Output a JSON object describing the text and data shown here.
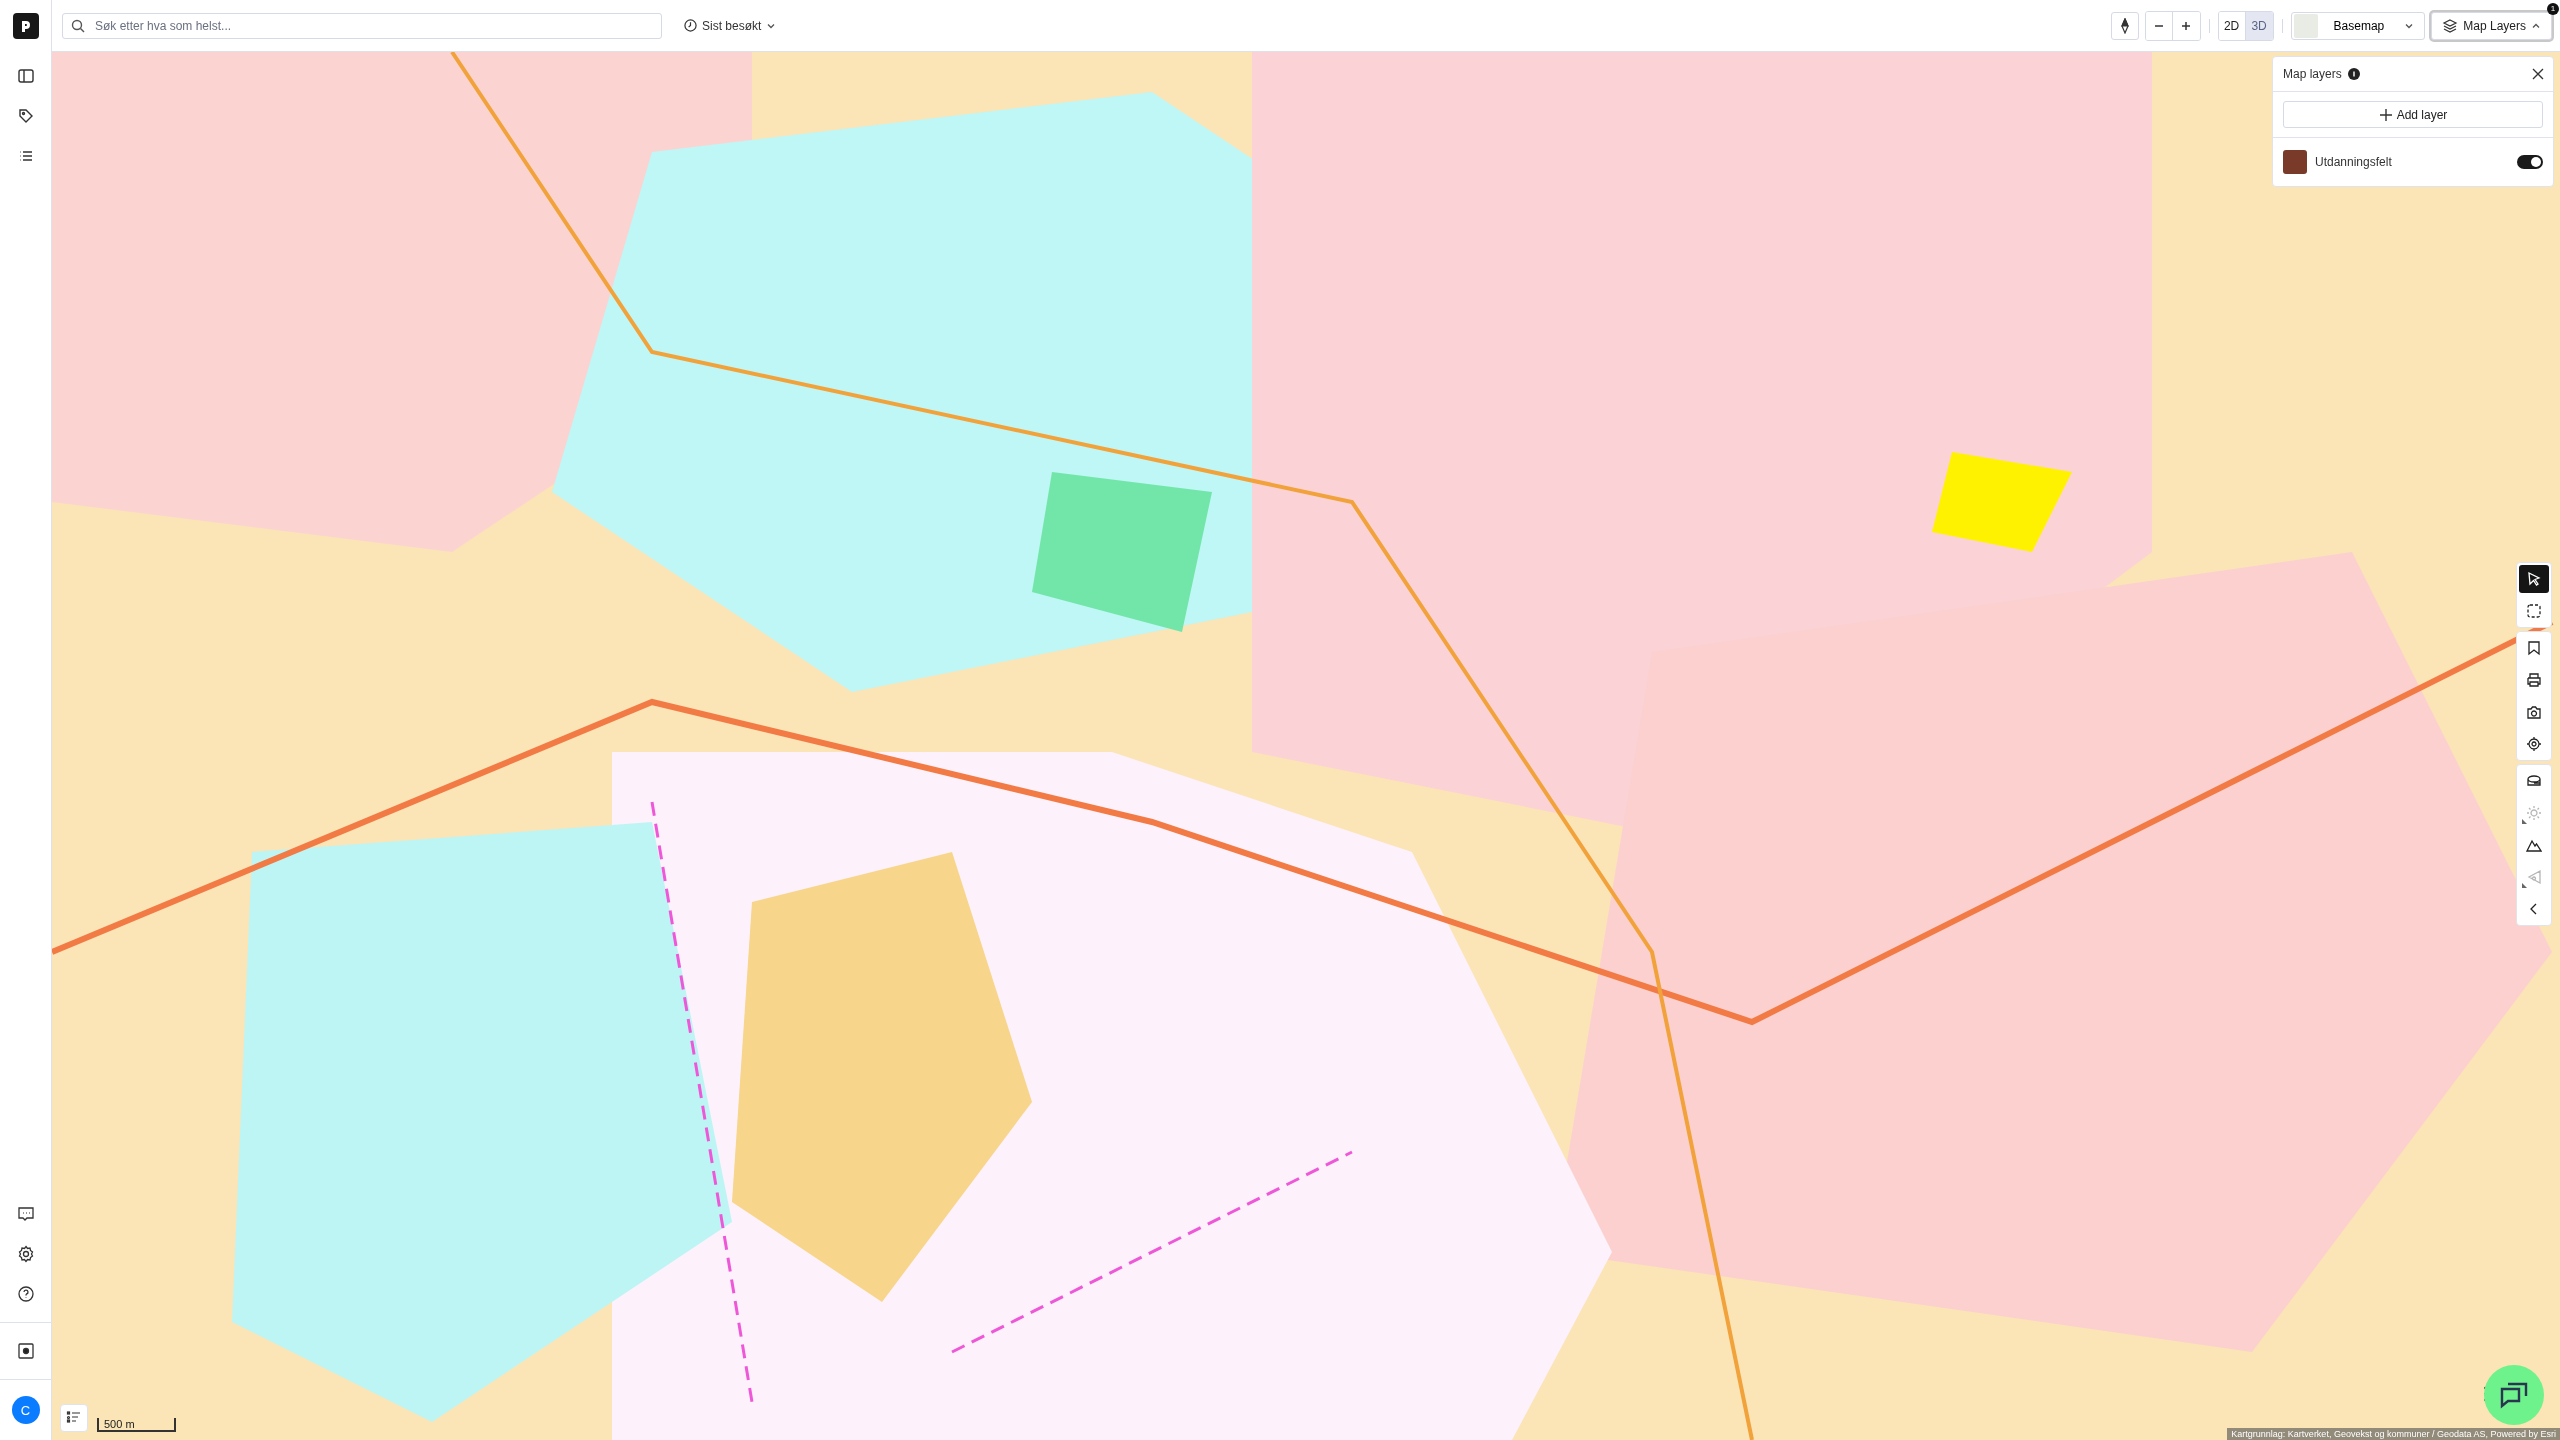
{
  "sidebar": {
    "top_items": [
      {
        "kind": "panel",
        "selected": false
      },
      {
        "kind": "tag",
        "selected": false
      },
      {
        "kind": "list",
        "selected": false
      }
    ],
    "bottom_items": [
      {
        "kind": "chat"
      },
      {
        "kind": "settings"
      },
      {
        "kind": "help"
      }
    ],
    "avatar": "C"
  },
  "search": {
    "placeholder": "Søk etter hva som helst..."
  },
  "recent": {
    "label": "Sist besøkt"
  },
  "view_modes": [
    {
      "label": "2D",
      "selected": false
    },
    {
      "label": "3D",
      "selected": true
    }
  ],
  "basemap": {
    "label": "Basemap"
  },
  "map_layers_button": {
    "label": "Map Layers",
    "badge": "1",
    "expanded": true
  },
  "layers_panel": {
    "title": "Map layers",
    "add_label": "Add layer",
    "layers": [
      {
        "name": "Utdanningsfelt",
        "on": true
      }
    ]
  },
  "tools": [
    [
      {
        "kind": "pointer",
        "selected": true,
        "disabled": false
      },
      {
        "kind": "area-select",
        "selected": false,
        "disabled": false
      }
    ],
    [
      {
        "kind": "bookmark",
        "selected": false,
        "disabled": false
      },
      {
        "kind": "print",
        "selected": false,
        "disabled": false
      },
      {
        "kind": "camera",
        "selected": false,
        "disabled": false
      },
      {
        "kind": "locate",
        "selected": false,
        "disabled": false
      }
    ],
    [
      {
        "kind": "measure",
        "selected": false,
        "disabled": false
      },
      {
        "kind": "sun",
        "selected": false,
        "disabled": true
      },
      {
        "kind": "terrain",
        "selected": false,
        "disabled": false
      },
      {
        "kind": "view",
        "selected": false,
        "disabled": true
      },
      {
        "kind": "collapse",
        "selected": false,
        "disabled": false
      }
    ]
  ],
  "scale": "500 m",
  "attribution": "Kartgrunnlag: Kartverket, Geovekst og kommuner / Geodata AS, Powered by Esri"
}
